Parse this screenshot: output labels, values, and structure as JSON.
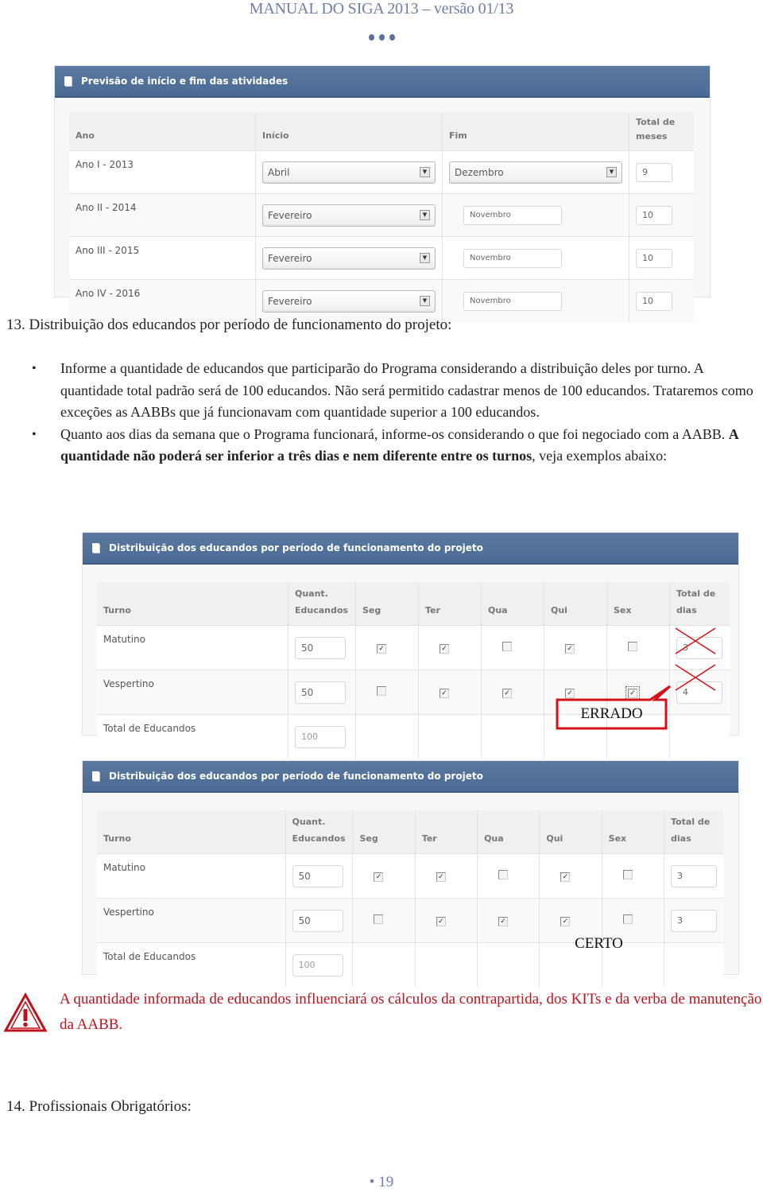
{
  "header": {
    "title": "MANUAL DO SIGA 2013 – versão 01/13"
  },
  "panel_previsao": {
    "title": "Previsão de início e fim das atividades",
    "columns": [
      "Ano",
      "Início",
      "Fim",
      "Total de meses"
    ],
    "rows": [
      {
        "ano": "Ano I - 2013",
        "inicio": "Abril",
        "fim": "Dezembro",
        "fim_is_select": true,
        "total": "9"
      },
      {
        "ano": "Ano II - 2014",
        "inicio": "Fevereiro",
        "fim": "Novembro",
        "fim_is_select": false,
        "total": "10"
      },
      {
        "ano": "Ano III - 2015",
        "inicio": "Fevereiro",
        "fim": "Novembro",
        "fim_is_select": false,
        "total": "10"
      },
      {
        "ano": "Ano IV - 2016",
        "inicio": "Fevereiro",
        "fim": "Novembro",
        "fim_is_select": false,
        "total": "10"
      }
    ]
  },
  "section13": {
    "title": "13. Distribuição dos educandos por período de funcionamento do projeto:",
    "bullet1": "Informe a quantidade de educandos que participarão do Programa considerando a distribuição deles por turno. A quantidade total padrão será de 100 educandos. Não será permitido cadastrar menos de 100 educandos. Trataremos como exceções as AABBs que já funcionavam com quantidade superior a 100 educandos.",
    "bullet2_start": "Quanto aos dias da semana que o Programa funcionará, informe-os considerando o que foi negociado com a AABB. ",
    "bullet2_bold": "A quantidade não poderá ser inferior a três dias e nem diferente entre os turnos",
    "bullet2_end": ", veja exemplos abaixo:"
  },
  "panel_distribuicao": {
    "title": "Distribuição dos educandos por período de funcionamento do projeto",
    "columns": {
      "turno": "Turno",
      "quant": "Quant. Educandos",
      "seg": "Seg",
      "ter": "Ter",
      "qua": "Qua",
      "qui": "Qui",
      "sex": "Sex",
      "total": "Total de dias"
    },
    "total_label": "Total de Educandos"
  },
  "example_errado": {
    "label": "ERRADO",
    "rows": [
      {
        "turno": "Matutino",
        "quant": "50",
        "days": [
          true,
          true,
          false,
          true,
          false
        ],
        "total": "3"
      },
      {
        "turno": "Vespertino",
        "quant": "50",
        "days": [
          false,
          true,
          true,
          true,
          true
        ],
        "total": "4"
      }
    ],
    "total_educandos": "100"
  },
  "example_certo": {
    "label": "CERTO",
    "rows": [
      {
        "turno": "Matutino",
        "quant": "50",
        "days": [
          true,
          true,
          false,
          true,
          false
        ],
        "total": "3"
      },
      {
        "turno": "Vespertino",
        "quant": "50",
        "days": [
          false,
          true,
          true,
          true,
          false
        ],
        "total": "3"
      }
    ],
    "total_educandos": "100"
  },
  "warning": {
    "text": "A quantidade informada de educandos influenciará os cálculos da contrapartida, dos KITs e da verba de manutenção da AABB.",
    "color": "#c0121b"
  },
  "section14": {
    "title": "14. Profissionais Obrigatórios:"
  },
  "footer": {
    "page_number": "• 19"
  }
}
